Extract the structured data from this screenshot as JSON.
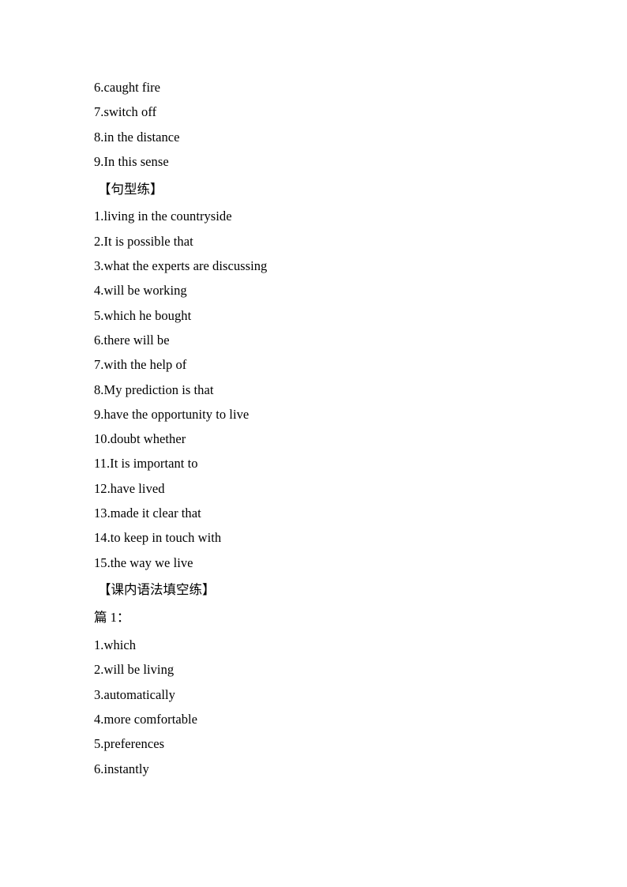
{
  "document": {
    "page_background": "#ffffff",
    "text_color": "#000000",
    "blocks": [
      {
        "type": "list",
        "items": [
          "6.caught fire",
          "7.switch off",
          "8.in the distance",
          "9.In this sense"
        ]
      },
      {
        "type": "section-heading",
        "text": "【句型练】"
      },
      {
        "type": "list",
        "items": [
          "1.living in the countryside",
          "2.It is possible that",
          "3.what the experts are discussing",
          "4.will be working",
          "5.which he bought",
          "6.there will be",
          "7.with the help of",
          "8.My prediction is that",
          "9.have the opportunity to live",
          "10.doubt whether",
          "11.It is important to",
          "12.have lived",
          "13.made it clear that",
          "14.to keep in touch with",
          "15.the way we live"
        ]
      },
      {
        "type": "section-heading",
        "text": "【课内语法填空练】"
      },
      {
        "type": "sub-heading",
        "text": "篇 1："
      },
      {
        "type": "list",
        "items": [
          "1.which",
          "2.will be living",
          "3.automatically",
          "4.more comfortable",
          "5.preferences",
          "6.instantly"
        ]
      }
    ]
  }
}
